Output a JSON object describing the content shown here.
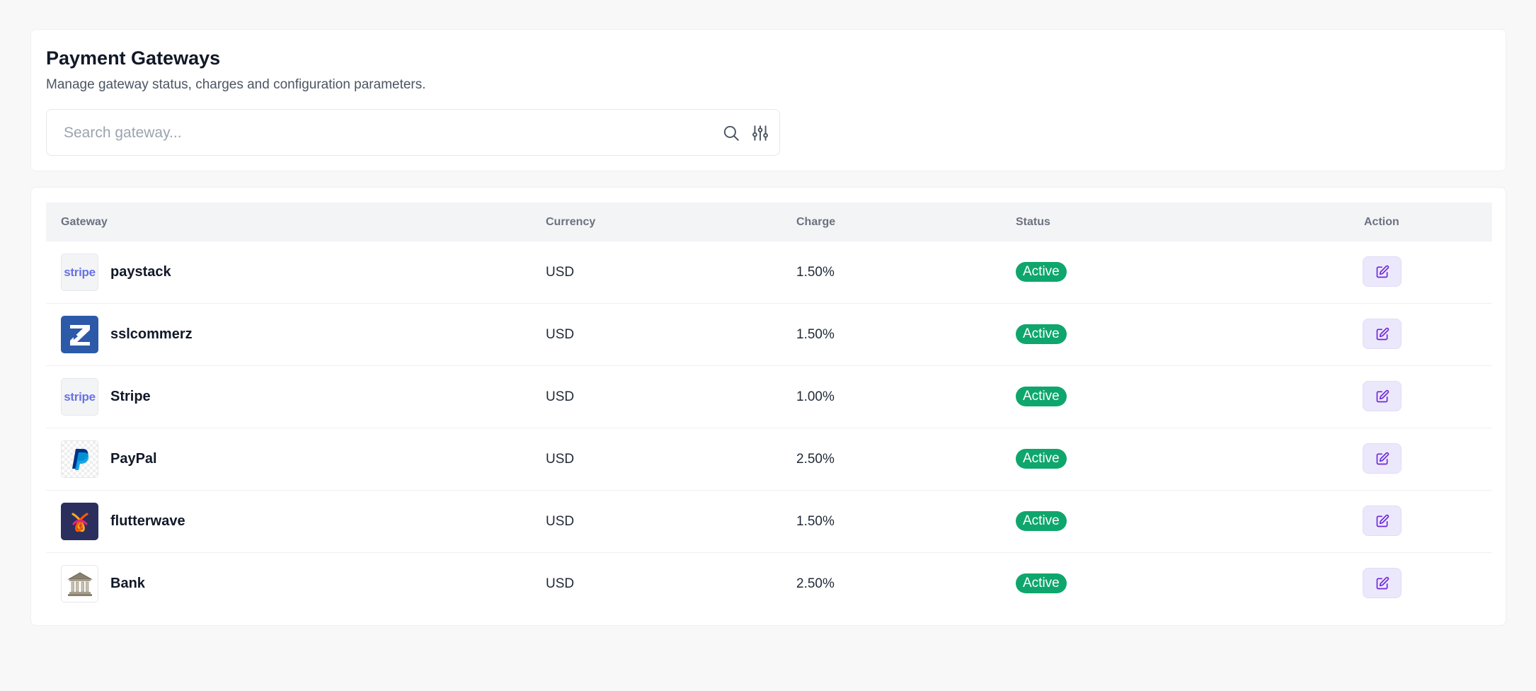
{
  "header": {
    "title": "Payment Gateways",
    "subtitle": "Manage gateway status, charges and configuration parameters."
  },
  "search": {
    "placeholder": "Search gateway...",
    "value": "",
    "search_icon": "search-icon",
    "filter_icon": "sliders-icon"
  },
  "table": {
    "columns": [
      "Gateway",
      "Currency",
      "Charge",
      "Status",
      "Action"
    ],
    "rows": [
      {
        "logo": "stripe-logo",
        "name": "paystack",
        "currency": "USD",
        "charge": "1.50%",
        "status": "Active"
      },
      {
        "logo": "sslcommerz-logo",
        "name": "sslcommerz",
        "currency": "USD",
        "charge": "1.50%",
        "status": "Active"
      },
      {
        "logo": "stripe-logo",
        "name": "Stripe",
        "currency": "USD",
        "charge": "1.00%",
        "status": "Active"
      },
      {
        "logo": "paypal-logo",
        "name": "PayPal",
        "currency": "USD",
        "charge": "2.50%",
        "status": "Active"
      },
      {
        "logo": "flutterwave-logo",
        "name": "flutterwave",
        "currency": "USD",
        "charge": "1.50%",
        "status": "Active"
      },
      {
        "logo": "bank-logo",
        "name": "Bank",
        "currency": "USD",
        "charge": "2.50%",
        "status": "Active"
      }
    ]
  },
  "logo_text": {
    "stripe": "stripe"
  },
  "colors": {
    "accent": "#7c3aed",
    "active_badge": "#0ea66c",
    "edit_button_bg": "#ece8fb"
  }
}
